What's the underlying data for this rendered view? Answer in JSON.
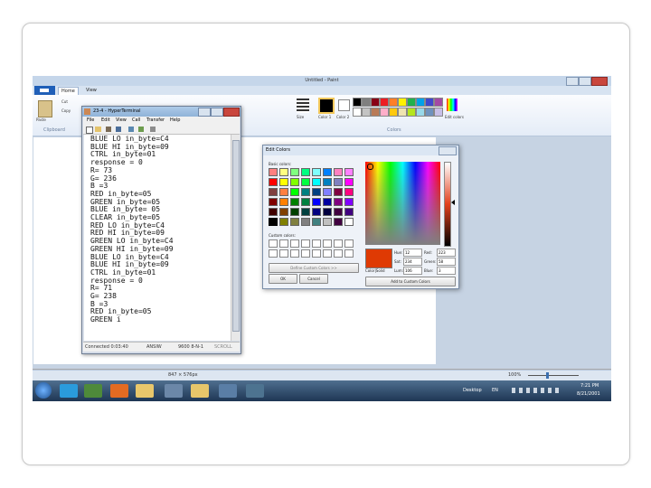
{
  "paint": {
    "title": "Untitled - Paint",
    "tabs": [
      "Home",
      "View"
    ],
    "groups": [
      "Clipboard",
      "Colors"
    ],
    "ribbon_buttons": [
      "Paste",
      "Cut",
      "Copy",
      "Size",
      "Color 1",
      "Color 2",
      "Edit colors"
    ],
    "status": {
      "dimensions": "847 × 576px",
      "zoom": "100%"
    }
  },
  "terminal": {
    "title": "23-4 - HyperTerminal",
    "menu": [
      "File",
      "Edit",
      "View",
      "Call",
      "Transfer",
      "Help"
    ],
    "lines": [
      "BLUE LO in_byte=C4",
      "BLUE HI in_byte=09",
      "CTRL in_byte=01",
      "response = 0",
      "R= 73",
      "G= 236",
      "B =3",
      "RED in_byte=05",
      "GREEN in_byte=05",
      "BLUE in_byte= 05",
      "CLEAR in_byte=05",
      "RED LO in_byte=C4",
      "RED HI in_byte=09",
      "GREEN LO in_byte=C4",
      "GREEN HI in_byte=09",
      "BLUE LO in_byte=C4",
      "BLUE HI in_byte=09",
      "CTRL in_byte=01",
      "response = 0",
      "R= 71",
      "G= 238",
      "B =3",
      "RED in_byte=05",
      "GREEN i"
    ],
    "status": [
      "Connected 0:03:40",
      "ANSIW",
      "9600 8-N-1",
      "SCROLL"
    ]
  },
  "edit_colors": {
    "title": "Edit Colors",
    "basic_colors_label": "Basic colors:",
    "custom_colors_label": "Custom colors:",
    "define_button": "Define Custom Colors >>",
    "ok": "OK",
    "cancel": "Cancel",
    "add_button": "Add to Custom Colors",
    "color_solid_label": "Color|Solid",
    "fields": {
      "hue_label": "Hue:",
      "hue": "12",
      "sat_label": "Sat:",
      "sat": "234",
      "lum_label": "Lum:",
      "lum": "106",
      "red_label": "Red:",
      "red": "223",
      "green_label": "Green:",
      "green": "58",
      "blue_label": "Blue:",
      "blue": "3"
    },
    "selected_color": "#df3a03",
    "basic_colors": [
      "#ff8080",
      "#ffff80",
      "#80ff80",
      "#00ff80",
      "#80ffff",
      "#0080ff",
      "#ff80c0",
      "#ff80ff",
      "#ff0000",
      "#ffff00",
      "#80ff00",
      "#00ff40",
      "#00ffff",
      "#0080c0",
      "#8080c0",
      "#ff00ff",
      "#804040",
      "#ff8040",
      "#00ff00",
      "#008080",
      "#004080",
      "#8080ff",
      "#800040",
      "#ff0080",
      "#800000",
      "#ff8000",
      "#008000",
      "#008040",
      "#0000ff",
      "#0000a0",
      "#800080",
      "#8000ff",
      "#400000",
      "#804000",
      "#004000",
      "#004040",
      "#000080",
      "#000040",
      "#400040",
      "#400080",
      "#000000",
      "#808000",
      "#808040",
      "#808080",
      "#408080",
      "#c0c0c0",
      "#400040",
      "#ffffff"
    ]
  },
  "taskbar": {
    "desktop_label": "Desktop",
    "lang": "EN",
    "time": "7:21 PM",
    "date": "8/21/2001"
  }
}
